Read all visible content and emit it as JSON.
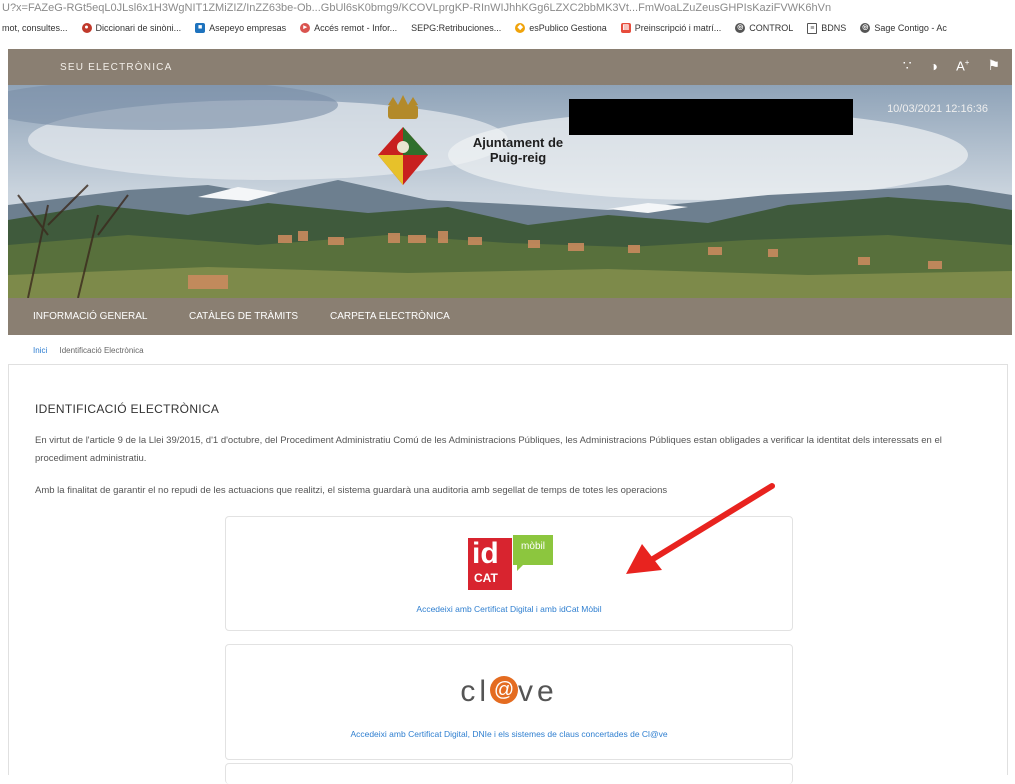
{
  "browser": {
    "url_fragment": "U?x=FAZeG-RGt5eqL0JLsl6x1H3WgNIT1ZMiZIZ/InZZ63be-Ob...GbUl6sK0bmg9/KCOVLprgKP-RInWIJhhKGg6LZXC2bbMK3Vt...FmWoaLZuZeusGHPIsKaziFVWK6hVn",
    "bookmarks": [
      {
        "label": "mot, consultes...",
        "icon": "none",
        "color": ""
      },
      {
        "label": "Diccionari de sinòni...",
        "icon": "dictionary-icon",
        "color": "#c0392b"
      },
      {
        "label": "Asepeyo empresas",
        "icon": "asepeyo-icon",
        "color": "#1e73be"
      },
      {
        "label": "Accés remot - Infor...",
        "icon": "remote-icon",
        "color": "#d9534f"
      },
      {
        "label": "SEPG:Retribuciones...",
        "icon": "none",
        "color": ""
      },
      {
        "label": "esPublico Gestiona",
        "icon": "espublico-icon",
        "color": "#f0a30a"
      },
      {
        "label": "Preinscripció i matrí...",
        "icon": "preinscripcio-icon",
        "color": "#e74c3c"
      },
      {
        "label": "CONTROL",
        "icon": "globe-icon",
        "color": "#555555"
      },
      {
        "label": "BDNS",
        "icon": "doc-icon",
        "color": "#555555"
      },
      {
        "label": "Sage Contigo - Ac",
        "icon": "globe-icon",
        "color": "#555555"
      }
    ]
  },
  "site": {
    "title": "SEU ELECTRÒNICA",
    "tools": [
      "sitemap-icon",
      "contrast-icon",
      "font-size-icon",
      "flag-icon"
    ],
    "datetime": "10/03/2021 12:16:36",
    "town_line1": "Ajuntament de",
    "town_line2": "Puig-reig"
  },
  "nav": [
    "INFORMACIÓ GENERAL",
    "CATÀLEG DE TRÀMITS",
    "CARPETA ELECTRÒNICA"
  ],
  "breadcrumb": {
    "home": "Inici",
    "current": "Identificació Electrònica"
  },
  "main": {
    "heading": "IDENTIFICACIÓ ELECTRÒNICA",
    "paragraph1": "En virtut de l'article 9 de la Llei 39/2015, d'1 d'octubre, del Procediment Administratiu Comú de les Administracions Públiques, les Administracions Públiques estan obligades a verificar la identitat dels interessats en el procediment administratiu.",
    "paragraph2": "Amb la finalitat de garantir el no repudi de les actuacions que realitzi, el sistema guardarà una auditoria amb segellat de temps de totes les operacions",
    "idcat_id": "id",
    "idcat_cat": "CAT",
    "idcat_mobil": "mòbil",
    "idcat_link": "Accedeixi amb Certificat Digital i amb idCat Mòbil",
    "clave_before": "cl",
    "clave_after": "ve",
    "clave_link": "Accedeixi amb Certificat Digital, DNIe i els sistemes de claus concertades de Cl@ve"
  },
  "colors": {
    "brand_bar": "#8a7f72",
    "link": "#2f7fd0",
    "idcat_red": "#d8242f",
    "mobil_green": "#8cc63e",
    "clave_orange": "#e46c21",
    "annotation_arrow": "#e8231f"
  }
}
